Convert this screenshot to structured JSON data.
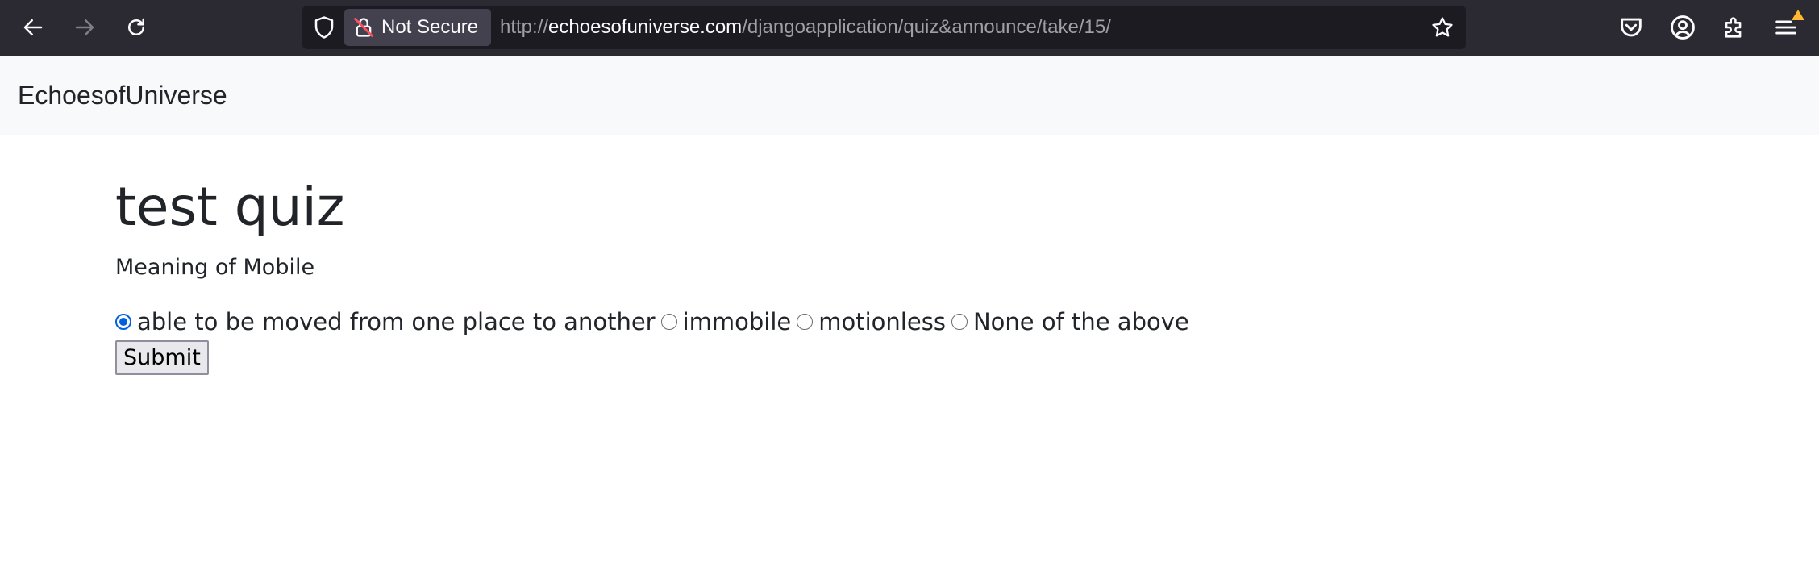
{
  "browser": {
    "security_label": "Not Secure",
    "url_scheme": "http://",
    "url_host": "echoesofuniverse.com",
    "url_path": "/djangoapplication/quiz&announce/take/15/"
  },
  "navbar": {
    "brand": "EchoesofUniverse"
  },
  "quiz": {
    "title": "test quiz",
    "question": "Meaning of Mobile",
    "options": [
      {
        "label": "able to be moved from one place to another",
        "selected": true
      },
      {
        "label": "immobile",
        "selected": false
      },
      {
        "label": "motionless",
        "selected": false
      },
      {
        "label": "None of the above",
        "selected": false
      }
    ],
    "submit_label": "Submit"
  },
  "colors": {
    "toolbar": "#2b2a33",
    "urlbar": "#1c1b22",
    "accent": "#0060df",
    "navbar_bg": "#f8f9fa"
  }
}
